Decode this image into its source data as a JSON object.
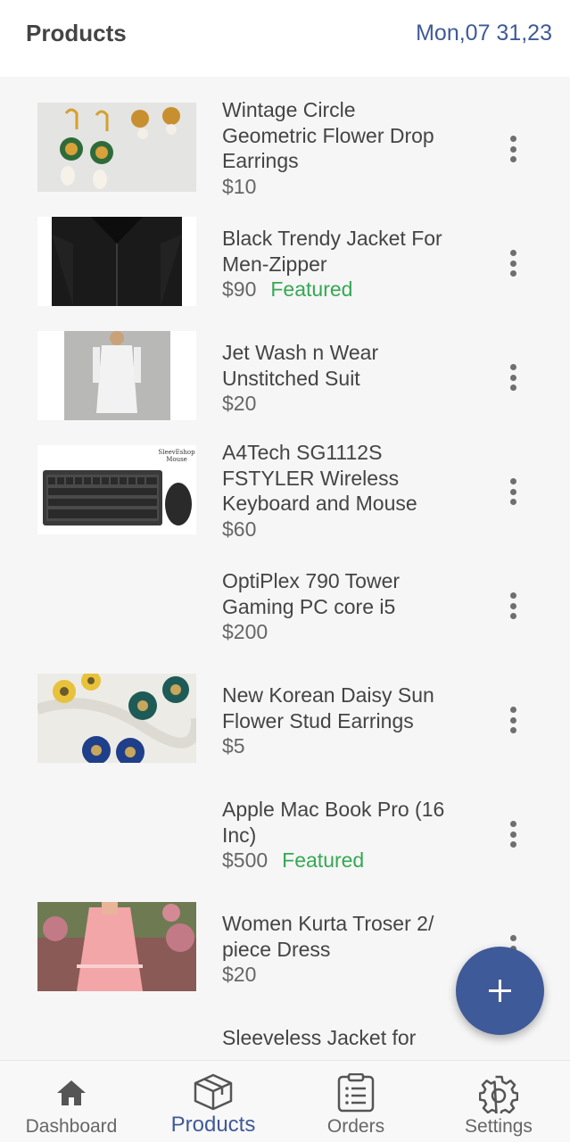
{
  "header": {
    "title": "Products",
    "date": "Mon,07 31,23"
  },
  "products": [
    {
      "name": "Wintage Circle\nGeometric Flower Drop\nEarrings",
      "price": "$10",
      "featured": ""
    },
    {
      "name": "Black Trendy Jacket For\nMen-Zipper",
      "price": "$90",
      "featured": "Featured"
    },
    {
      "name": "Jet Wash n Wear\nUnstitched Suit",
      "price": "$20",
      "featured": ""
    },
    {
      "name": "A4Tech SG1112S\nFSTYLER Wireless\nKeyboard and Mouse",
      "price": "$60",
      "featured": ""
    },
    {
      "name": "OptiPlex 790 Tower\nGaming PC core i5",
      "price": "$200",
      "featured": ""
    },
    {
      "name": "New  Korean Daisy Sun\nFlower Stud Earrings",
      "price": "$5",
      "featured": ""
    },
    {
      "name": "Apple Mac Book Pro (16\nInc)",
      "price": "$500",
      "featured": "Featured"
    },
    {
      "name": "Women Kurta Troser 2/\npiece Dress",
      "price": "$20",
      "featured": ""
    },
    {
      "name": "Sleeveless Jacket for",
      "price": "",
      "featured": ""
    }
  ],
  "thumb_watermark": "SleevEshop\nMouse",
  "nav": {
    "dashboard": "Dashboard",
    "products": "Products",
    "orders": "Orders",
    "settings": "Settings"
  },
  "colors": {
    "accent": "#3f5a99",
    "featured": "#35a853"
  }
}
